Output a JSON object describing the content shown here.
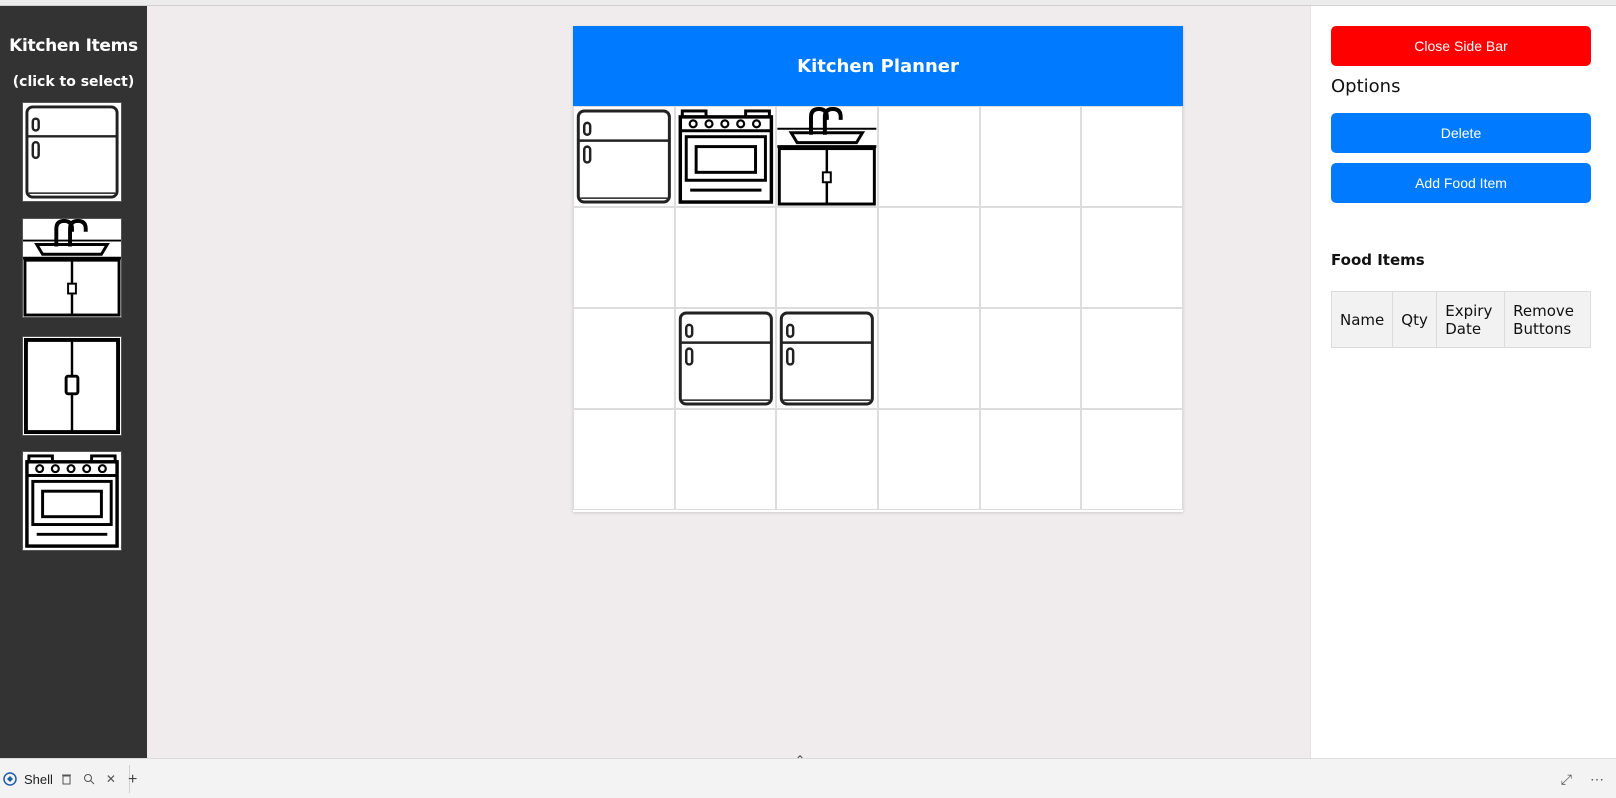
{
  "left_sidebar": {
    "title": "Kitchen Items",
    "subtitle": "(click to select)",
    "items": [
      {
        "icon": "fridge-icon"
      },
      {
        "icon": "sink-icon"
      },
      {
        "icon": "cabinet-icon"
      },
      {
        "icon": "stove-icon"
      }
    ]
  },
  "planner": {
    "title": "Kitchen Planner",
    "grid": [
      [
        "fridge",
        "stove",
        "sink",
        "",
        "",
        ""
      ],
      [
        "",
        "",
        "",
        "",
        "",
        ""
      ],
      [
        "",
        "fridge",
        "fridge",
        "",
        "",
        ""
      ],
      [
        "",
        "",
        "",
        "",
        "",
        ""
      ]
    ]
  },
  "right_sidebar": {
    "close_label": "Close Side Bar",
    "options_title": "Options",
    "delete_label": "Delete",
    "add_food_label": "Add Food Item",
    "food_items_title": "Food Items",
    "columns": [
      "Name",
      "Qty",
      "Expiry Date",
      "Remove Buttons"
    ]
  },
  "taskbar": {
    "tab_label": "Shell"
  },
  "colors": {
    "accent": "#007bff",
    "danger": "#ff0000",
    "sidebar_bg": "#333333"
  }
}
